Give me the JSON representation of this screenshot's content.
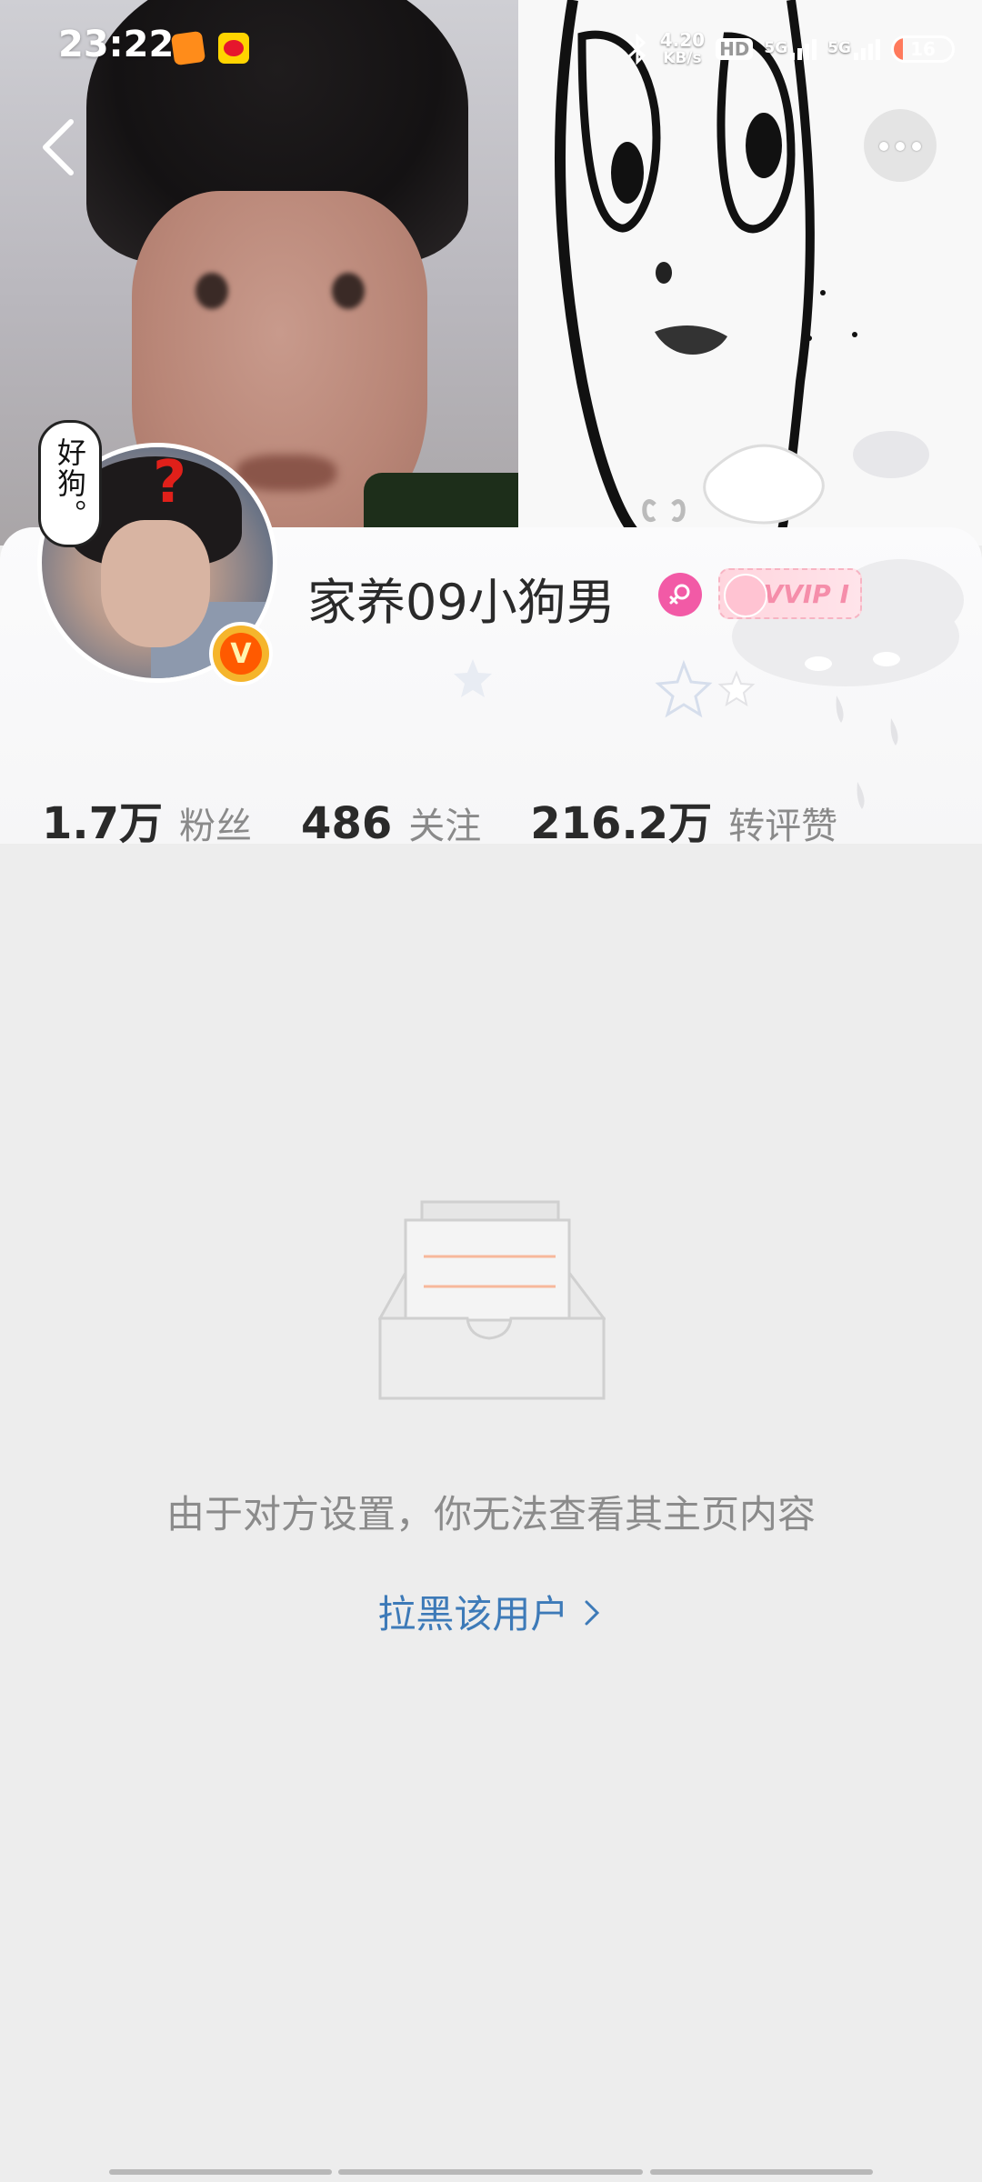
{
  "status_bar": {
    "time": "23:22",
    "net_speed_value": "4.20",
    "net_speed_unit": "KB/s",
    "hd_label": "HD",
    "signal1_label": "5G",
    "signal2_label": "5G",
    "battery_level": "16",
    "battery_fraction": 0.16,
    "icons": [
      "bluetooth-icon",
      "hd-voice-icon",
      "signal-5g-icon",
      "signal-5g-icon",
      "battery-icon"
    ]
  },
  "nav": {
    "back_icon": "chevron-left-icon",
    "more_icon": "more-horizontal-icon"
  },
  "profile": {
    "avatar_caption": "好狗。",
    "username": "家养09小狗男",
    "gender": "female",
    "vip_label": "VVIP I",
    "verified_mark": "V",
    "stats": [
      {
        "value": "1.7万",
        "label": "粉丝"
      },
      {
        "value": "486",
        "label": "关注"
      },
      {
        "value": "216.2万",
        "label": "转评赞"
      }
    ]
  },
  "empty_state": {
    "icon": "empty-inbox-icon",
    "message": "由于对方设置，你无法查看其主页内容",
    "action_label": "拉黑该用户"
  },
  "colors": {
    "accent_link": "#3d7ab8",
    "page_background": "#ededed",
    "gender_female": "#f25aa6",
    "vip_pink": "#f58eaa"
  }
}
